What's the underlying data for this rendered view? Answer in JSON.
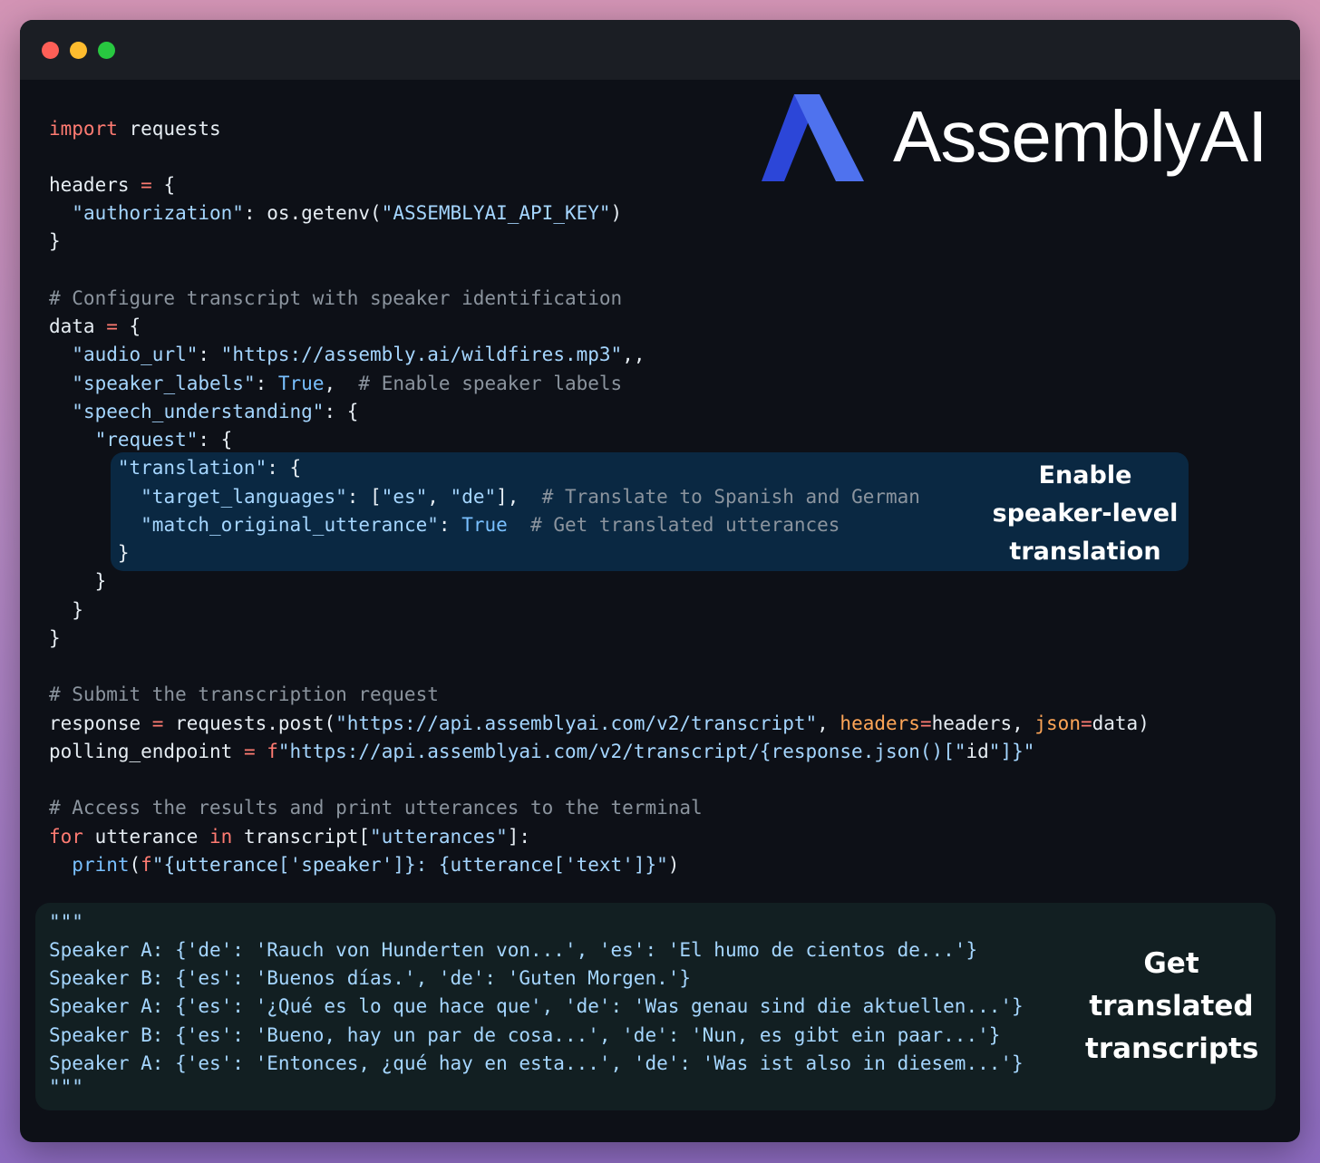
{
  "window": {
    "traffic_lights": [
      {
        "name": "close",
        "color": "#fe5f57"
      },
      {
        "name": "minimize",
        "color": "#febc2e"
      },
      {
        "name": "maximize",
        "color": "#28c840"
      }
    ]
  },
  "logo": {
    "text": "AssemblyAI",
    "mark_icon": "assemblyai-logo-icon",
    "mark_colors": [
      "#2c46d8",
      "#4f72ee"
    ]
  },
  "code": {
    "line1": "import requests",
    "line3": "headers = {",
    "line4": "  \"authorization\": os.getenv(\"ASSEMBLYAI_API_KEY\")",
    "line5": "}",
    "line7": "# Configure transcript with speaker identification",
    "line8": "data = {",
    "line9": "  \"audio_url\": \"https://assembly.ai/wildfires.mp3\",,",
    "line10": "  \"speaker_labels\": True,  # Enable speaker labels",
    "line11": "  \"speech_understanding\": {",
    "line12": "    \"request\": {",
    "line13": "      \"translation\": {",
    "line14": "        \"target_languages\": [\"es\", \"de\"],  # Translate to Spanish and German",
    "line15": "        \"match_original_utterance\": True  # Get translated utterances",
    "line16": "      }",
    "line17": "    }",
    "line18": "  }",
    "line19": "}",
    "line21": "# Submit the transcription request",
    "line22": "response = requests.post(\"https://api.assemblyai.com/v2/transcript\", headers=headers, json=data)",
    "line23": "polling_endpoint = f\"https://api.assemblyai.com/v2/transcript/{response.json()[\"id\"]}\"",
    "line25": "# Access the results and print utterances to the terminal",
    "line26": "for utterance in transcript[\"utterances\"]:",
    "line27": "  print(f\"{utterance['speaker']}: {utterance['text']}\")"
  },
  "output": {
    "open_quotes": "\"\"\"",
    "lines": [
      "Speaker A: {'de': 'Rauch von Hunderten von...', 'es': 'El humo de cientos de...'}",
      "Speaker B: {'es': 'Buenos días.', 'de': 'Guten Morgen.'}",
      "Speaker A: {'es': '¿Qué es lo que hace que', 'de': 'Was genau sind die aktuellen...'}",
      "Speaker B: {'es': 'Bueno, hay un par de cosa...', 'de': 'Nun, es gibt ein paar...'}",
      "Speaker A: {'es': 'Entonces, ¿qué hay en esta...', 'de': 'Was ist also in diesem...'}"
    ],
    "close_quotes": "\"\"\""
  },
  "callouts": {
    "translation": [
      "Enable",
      "speaker-level",
      "translation"
    ],
    "transcripts": [
      "Get",
      "translated",
      "transcripts"
    ]
  }
}
